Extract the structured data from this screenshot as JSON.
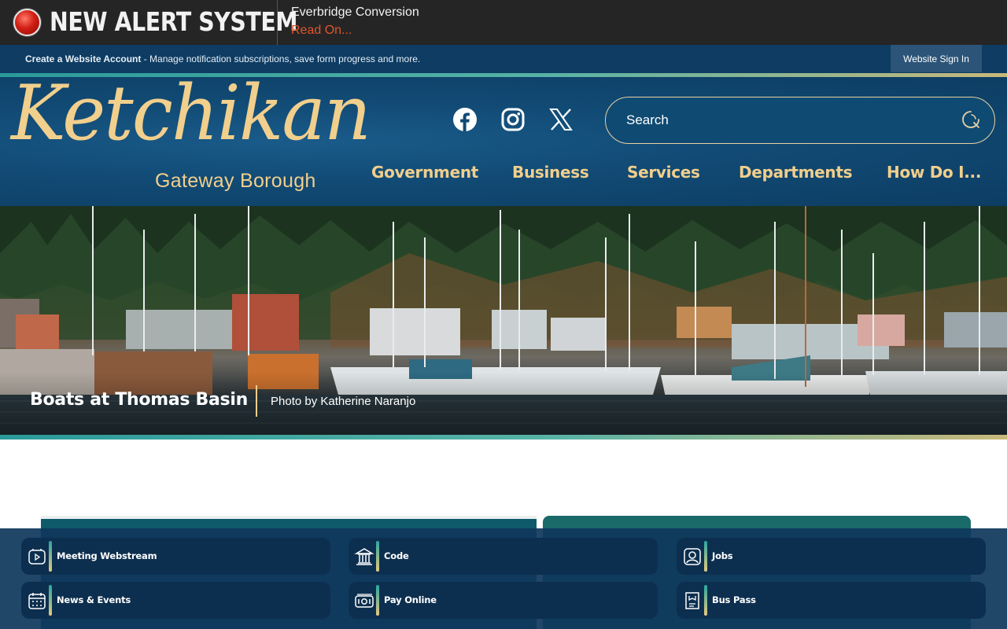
{
  "alert": {
    "title": "NEW ALERT SYSTEM",
    "headline": "Everbridge Conversion",
    "read_on": "Read On..."
  },
  "account_bar": {
    "create_label": "Create a Website Account",
    "description": " - Manage notification subscriptions, save form progress and more.",
    "sign_in": "Website Sign In"
  },
  "logo": {
    "name": "Ketchikan",
    "subtitle": "Gateway Borough"
  },
  "social": [
    {
      "name": "facebook-icon"
    },
    {
      "name": "instagram-icon"
    },
    {
      "name": "x-icon"
    }
  ],
  "search": {
    "placeholder": "Search"
  },
  "nav": {
    "items": [
      "Government",
      "Business",
      "Services",
      "Departments",
      "How Do I..."
    ]
  },
  "hero": {
    "caption_title": "Boats at Thomas Basin",
    "caption_credit": "Photo by Katherine Naranjo"
  },
  "quick_links": [
    {
      "label": "Meeting Webstream",
      "icon": "video-icon"
    },
    {
      "label": "Code",
      "icon": "building-icon"
    },
    {
      "label": "Jobs",
      "icon": "person-icon"
    },
    {
      "label": "News & Events",
      "icon": "calendar-icon"
    },
    {
      "label": "Pay Online",
      "icon": "money-icon"
    },
    {
      "label": "Bus Pass",
      "icon": "pass-icon"
    }
  ],
  "colors": {
    "alert_bg": "#252525",
    "alert_accent": "#e2542a",
    "brand_navy": "#0e3c63",
    "brand_gold": "#f1cf8c",
    "accent_teal": "#2a9a9a"
  }
}
